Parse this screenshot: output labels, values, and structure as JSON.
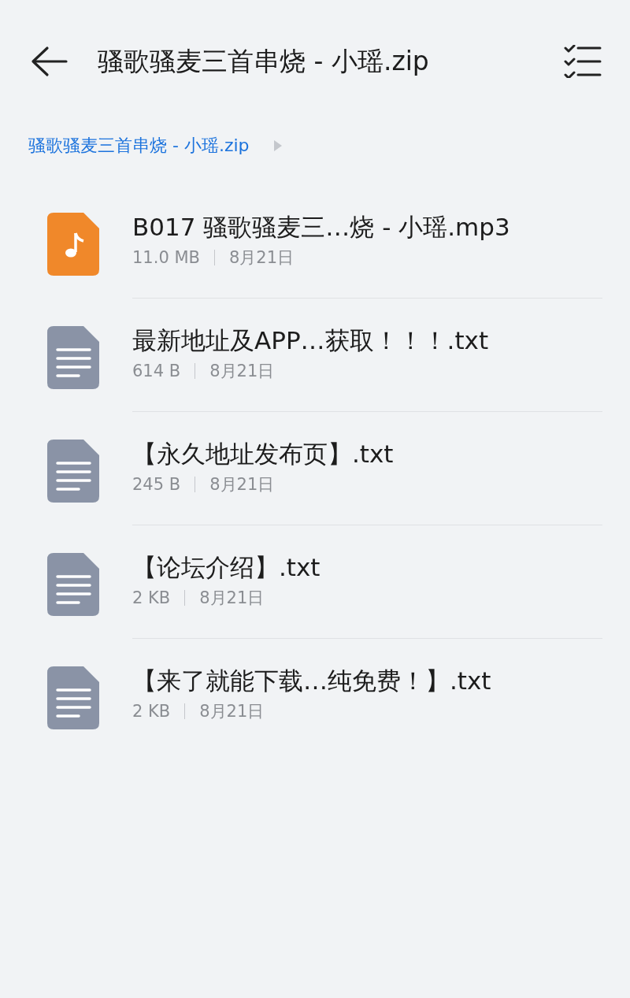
{
  "header": {
    "title": "骚歌骚麦三首串烧 - 小瑶.zip"
  },
  "breadcrumb": {
    "label": "骚歌骚麦三首串烧 - 小瑶.zip"
  },
  "files": [
    {
      "kind": "audio",
      "name": "B017 骚歌骚麦三…烧 - 小瑶.mp3",
      "size": "11.0 MB",
      "date": "8月21日"
    },
    {
      "kind": "text",
      "name": "最新地址及APP…获取！！！.txt",
      "size": "614 B",
      "date": "8月21日"
    },
    {
      "kind": "text",
      "name": "【永久地址发布页】.txt",
      "size": "245 B",
      "date": "8月21日"
    },
    {
      "kind": "text",
      "name": "【论坛介绍】.txt",
      "size": "2 KB",
      "date": "8月21日"
    },
    {
      "kind": "text",
      "name": "【来了就能下载…纯免费！】.txt",
      "size": "2 KB",
      "date": "8月21日"
    }
  ]
}
